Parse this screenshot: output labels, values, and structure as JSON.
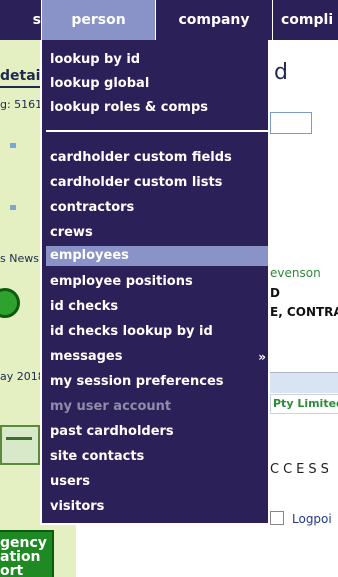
{
  "nav": {
    "tabs": [
      {
        "label": "s"
      },
      {
        "label": "person"
      },
      {
        "label": "company"
      },
      {
        "label": "compli"
      }
    ]
  },
  "sidebar": {
    "details": "detail",
    "code": "g: 5161",
    "news": "s News",
    "date": "ay 2018",
    "emergency_lines": [
      "gency",
      "ation",
      "ort"
    ]
  },
  "menu": {
    "items": [
      {
        "label": "lookup by id"
      },
      {
        "label": "lookup global"
      },
      {
        "label": "lookup roles & comps"
      },
      {
        "label": "cardholder custom fields"
      },
      {
        "label": "cardholder custom lists"
      },
      {
        "label": "contractors"
      },
      {
        "label": "crews"
      },
      {
        "label": "employees"
      },
      {
        "label": "employee positions"
      },
      {
        "label": "id checks"
      },
      {
        "label": "id checks lookup by id"
      },
      {
        "label": "messages",
        "arrow": "»"
      },
      {
        "label": "my session preferences"
      },
      {
        "label": "my user account"
      },
      {
        "label": "past cardholders"
      },
      {
        "label": "site contacts"
      },
      {
        "label": "users"
      },
      {
        "label": "visitors"
      }
    ]
  },
  "content": {
    "heading_fragment": "d",
    "stevenson": "evenson",
    "line_d": "D",
    "line_contra": "E, CONTRA",
    "company": "Pty Limited",
    "access_fragment": "CCESS",
    "logpoint_fragment": "Logpoi"
  },
  "colors": {
    "nav_bg": "#2b2158",
    "menu_highlight": "#8a93c8",
    "sidebar_bg": "#e4efc2",
    "emergency_green": "#1f8a24",
    "link_green": "#2e8b3a"
  }
}
